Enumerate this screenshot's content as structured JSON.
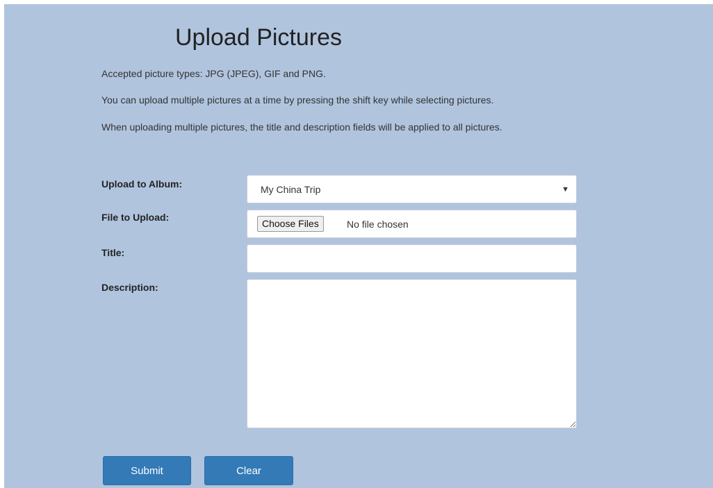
{
  "page": {
    "title": "Upload Pictures",
    "info_lines": [
      "Accepted picture types: JPG (JPEG), GIF and PNG.",
      "You can upload multiple pictures at a time by pressing the shift key while selecting pictures.",
      "When uploading multiple pictures, the title and description fields will be applied to all pictures."
    ]
  },
  "form": {
    "album": {
      "label": "Upload to Album:",
      "selected": "My China Trip",
      "arrow": "▼"
    },
    "file": {
      "label": "File to Upload:",
      "button_label": "Choose Files",
      "status": "No file chosen"
    },
    "title": {
      "label": "Title:",
      "value": ""
    },
    "description": {
      "label": "Description:",
      "value": ""
    },
    "buttons": {
      "submit": "Submit",
      "clear": "Clear"
    }
  },
  "colors": {
    "background": "#b0c4de",
    "button": "#337ab7",
    "button_text": "#ffffff"
  }
}
